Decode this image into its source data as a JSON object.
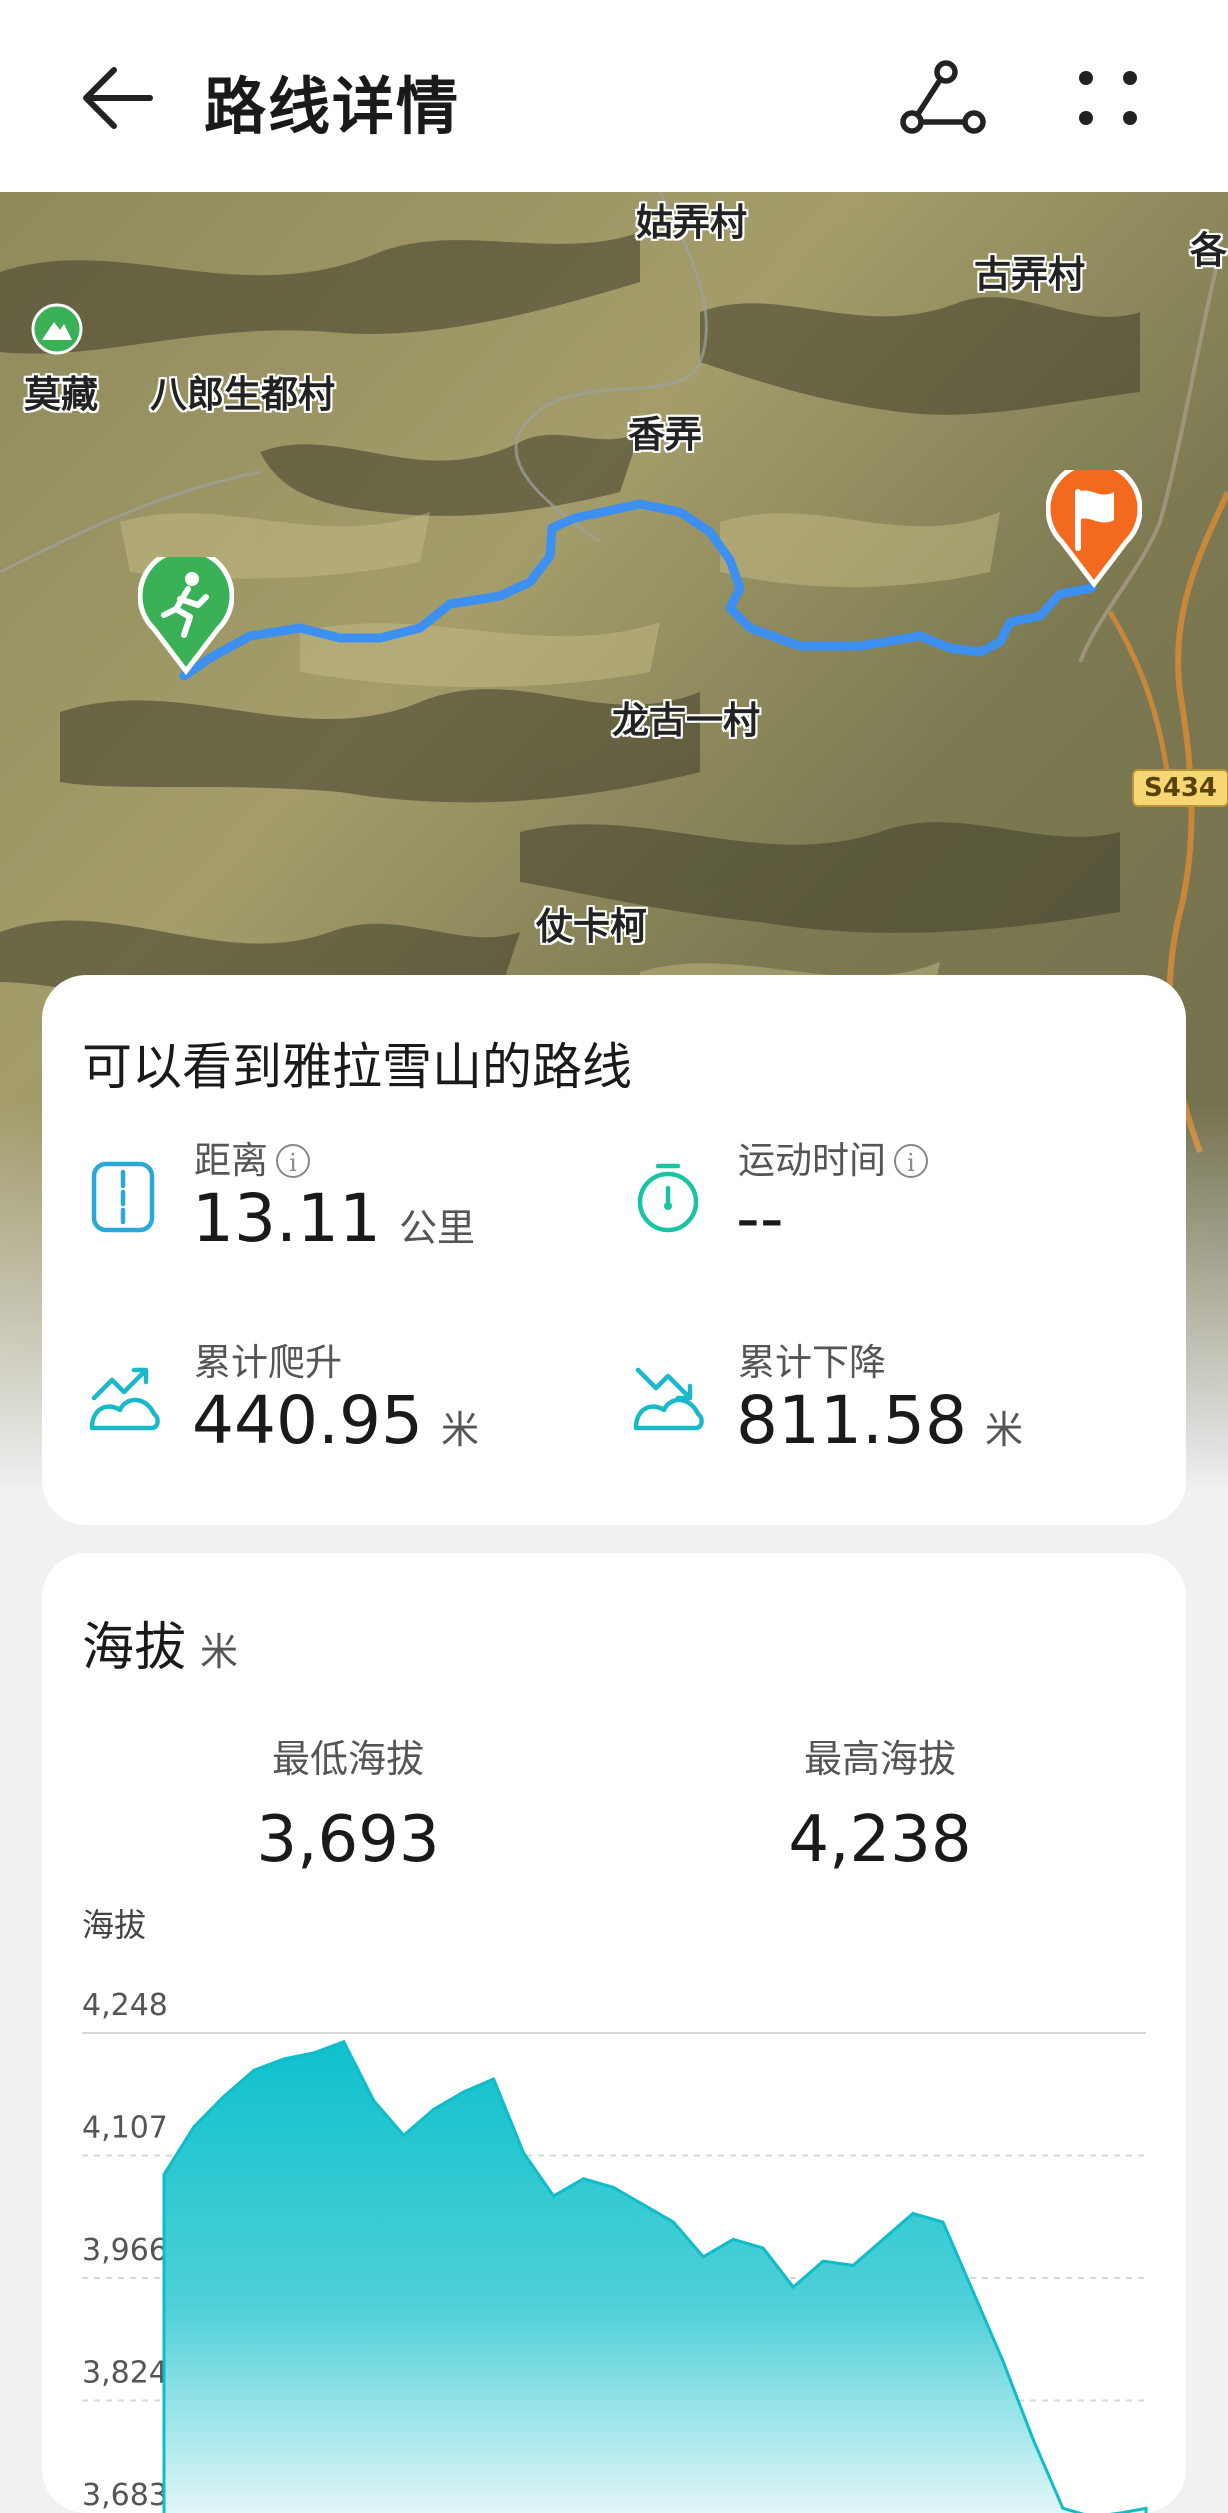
{
  "header": {
    "title": "路线详情",
    "back_icon": "arrow-left-icon",
    "share_icon": "route-share-icon",
    "more_icon": "more-dots-icon"
  },
  "map": {
    "labels": {
      "gunong": "姑弄村",
      "gunong2": "古弄村",
      "mozang": "莫藏",
      "balang": "八郎生都村",
      "xiangnong": "香弄",
      "longgu": "龙古一村",
      "zhangka": "仗卡柯",
      "edge": "各"
    },
    "road_badge": "S434",
    "start_icon": "running-person-icon",
    "end_icon": "finish-flag-icon",
    "route_color": "#3d8ff0"
  },
  "route": {
    "name": "可以看到雅拉雪山的路线",
    "stats": {
      "distance": {
        "label": "距离",
        "value": "13.11",
        "unit": "公里",
        "info": "i"
      },
      "duration": {
        "label": "运动时间",
        "value": "--",
        "info": "i"
      },
      "ascent": {
        "label": "累计爬升",
        "value": "440.95",
        "unit": "米"
      },
      "descent": {
        "label": "累计下降",
        "value": "811.58",
        "unit": "米"
      }
    }
  },
  "altitude": {
    "title": "海拔",
    "unit": "米",
    "min_label": "最低海拔",
    "min_value": "3,693",
    "max_label": "最高海拔",
    "max_value": "4,238",
    "chart_ylabel": "海拔"
  },
  "chart_data": {
    "type": "area",
    "title": "",
    "ylabel": "海拔",
    "xlabel": "",
    "ylim": [
      3683,
      4248
    ],
    "yticks": [
      "4,248",
      "4,107",
      "3,966",
      "3,824",
      "3,683"
    ],
    "grid": true,
    "fill_color": "#16c3cf",
    "x": [
      0,
      0.4,
      0.8,
      1.2,
      1.6,
      2.0,
      2.4,
      2.8,
      3.2,
      3.6,
      4.0,
      4.4,
      4.8,
      5.2,
      5.6,
      6.0,
      6.4,
      6.8,
      7.2,
      7.6,
      8.0,
      8.4,
      8.8,
      9.2,
      9.6,
      10.0,
      10.4,
      10.8,
      11.2,
      11.6,
      12.0,
      12.4,
      12.8,
      13.11
    ],
    "series": [
      {
        "values": [
          4085,
          4140,
          4175,
          4205,
          4218,
          4225,
          4238,
          4170,
          4130,
          4160,
          4180,
          4195,
          4110,
          4060,
          4080,
          4070,
          4050,
          4030,
          3990,
          4010,
          4000,
          3955,
          3985,
          3980,
          4010,
          4040,
          4030,
          3950,
          3870,
          3780,
          3700,
          3690,
          3695,
          3700
        ]
      }
    ]
  }
}
